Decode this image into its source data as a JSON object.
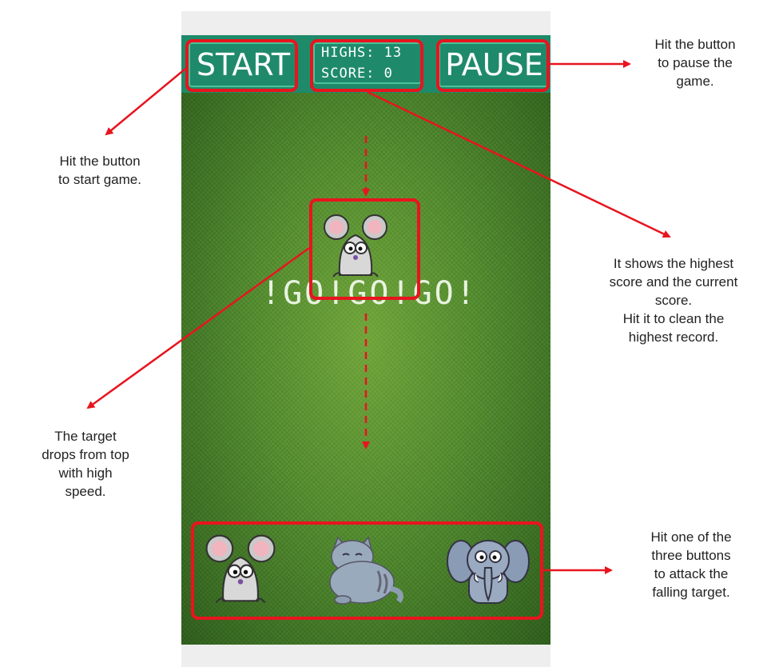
{
  "game": {
    "start_label": "START",
    "pause_label": "PAUSE",
    "highs_label": "HIGHS:",
    "highs_value": "13",
    "score_label": "SCORE:",
    "score_value": "0",
    "go_text": "!GO!GO!GO!",
    "falling_target": "mouse",
    "attack_buttons": [
      "mouse",
      "cat",
      "elephant"
    ]
  },
  "annotations": {
    "start": [
      "Hit the button",
      "to start game."
    ],
    "pause": [
      "Hit the button",
      "to pause the",
      "game."
    ],
    "score": [
      "It shows the highest",
      "score and the current",
      "score.",
      "Hit it to clean the",
      "highest record."
    ],
    "target": [
      "The target",
      "drops from top",
      "with high",
      "speed."
    ],
    "attack": [
      "Hit one of the",
      "three buttons",
      "to attack the",
      "falling target."
    ]
  },
  "colors": {
    "highlight": "#e8141e",
    "topbar": "#1e8a6a",
    "field": "#4f8a2b"
  }
}
